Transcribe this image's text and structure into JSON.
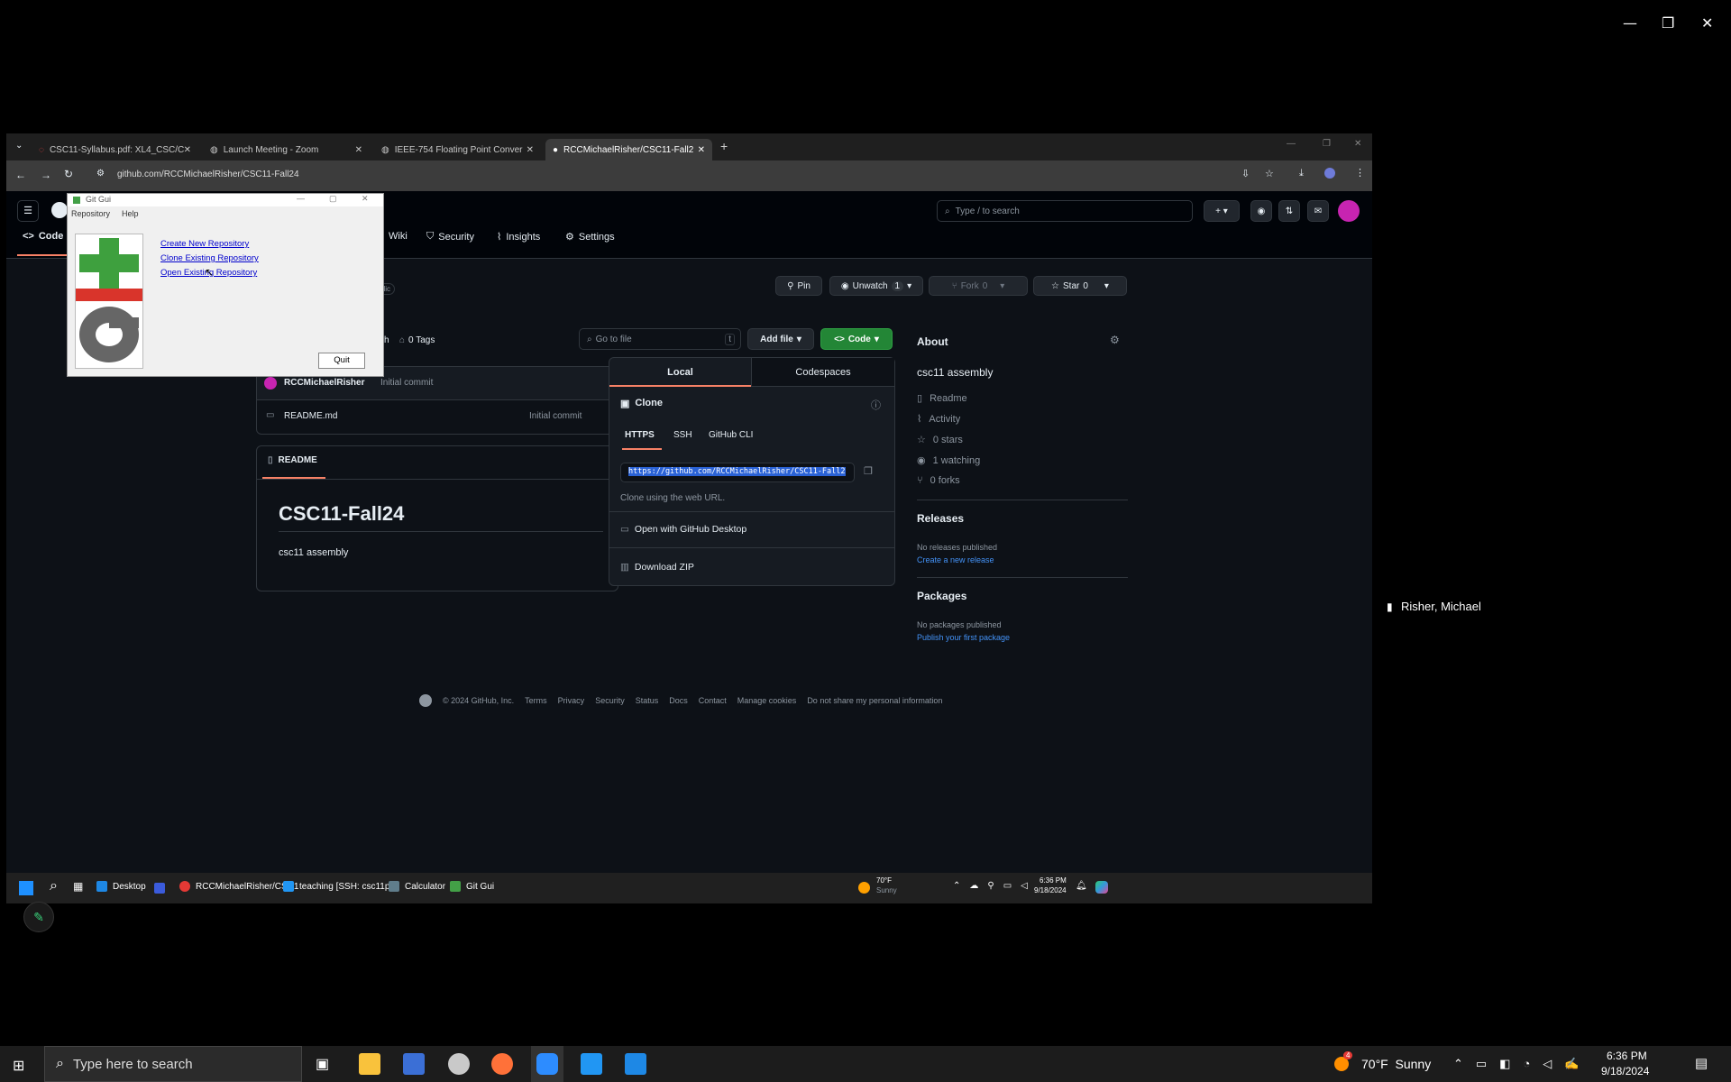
{
  "zoom_window": {
    "controls": [
      "—",
      "❐",
      "✕"
    ],
    "participant_name": "Risher, Michael"
  },
  "browser": {
    "tabs": [
      {
        "label": "CSC11-Syllabus.pdf: XL4_CSC/C"
      },
      {
        "label": "Launch Meeting - Zoom"
      },
      {
        "label": "IEEE-754 Floating Point Conver"
      },
      {
        "label": "RCCMichaelRisher/CSC11-Fall2"
      }
    ],
    "url": "github.com/RCCMichaelRisher/CSC11-Fall24"
  },
  "github": {
    "search_placeholder": "Type / to search",
    "nav": [
      "Code",
      "Wiki",
      "Security",
      "Insights",
      "Settings"
    ],
    "visibility_badge": "blic",
    "pin": "Pin",
    "unwatch": "Unwatch",
    "unwatch_count": "1",
    "fork": "Fork",
    "fork_count": "0",
    "star": "Star",
    "star_count": "0",
    "branch_fragment": "ch",
    "tags": "0 Tags",
    "go_to_file": "Go to file",
    "go_to_file_key": "t",
    "add_file": "Add file",
    "code_btn": "Code",
    "commit_author": "RCCMichaelRisher",
    "commit_msg": "Initial commit",
    "file_name": "README.md",
    "file_commit": "Initial commit",
    "readme_tab": "README",
    "readme_title": "CSC11-Fall24",
    "readme_body": "csc11 assembly",
    "clone": {
      "tab_local": "Local",
      "tab_codespaces": "Codespaces",
      "title": "Clone",
      "methods": [
        "HTTPS",
        "SSH",
        "GitHub CLI"
      ],
      "url": "https://github.com/RCCMichaelRisher/CSC11-Fall2",
      "hint": "Clone using the web URL.",
      "desktop": "Open with GitHub Desktop",
      "zip": "Download ZIP"
    },
    "about": {
      "title": "About",
      "desc": "csc11 assembly",
      "items": [
        "Readme",
        "Activity",
        "0 stars",
        "1 watching",
        "0 forks"
      ],
      "releases_title": "Releases",
      "releases_none": "No releases published",
      "releases_link": "Create a new release",
      "packages_title": "Packages",
      "packages_none": "No packages published",
      "packages_link": "Publish your first package"
    },
    "footer": [
      "© 2024 GitHub, Inc.",
      "Terms",
      "Privacy",
      "Security",
      "Status",
      "Docs",
      "Contact",
      "Manage cookies",
      "Do not share my personal information"
    ]
  },
  "gitgui": {
    "title": "Git Gui",
    "menus": [
      "Repository",
      "Help"
    ],
    "links": [
      "Create New Repository",
      "Clone Existing Repository",
      "Open Existing Repository"
    ],
    "quit": "Quit"
  },
  "inner_taskbar": {
    "desktop": "Desktop",
    "chrome": "RCCMichaelRisher/CSC1",
    "vscode": "teaching [SSH: csc11pi.d",
    "calc": "Calculator",
    "gitgui": "Git Gui",
    "weather_temp": "70°F",
    "weather_desc": "Sunny",
    "time": "6:36 PM",
    "date": "9/18/2024"
  },
  "taskbar": {
    "search_placeholder": "Type here to search",
    "weather": "70°F  Sunny",
    "weather_badge": "4",
    "time": "6:36 PM",
    "date": "9/18/2024"
  },
  "colors": {
    "github_bg": "#0d1117",
    "accent_green": "#238636",
    "link_blue": "#4493f8",
    "zoom_blue": "#2d8cff"
  }
}
